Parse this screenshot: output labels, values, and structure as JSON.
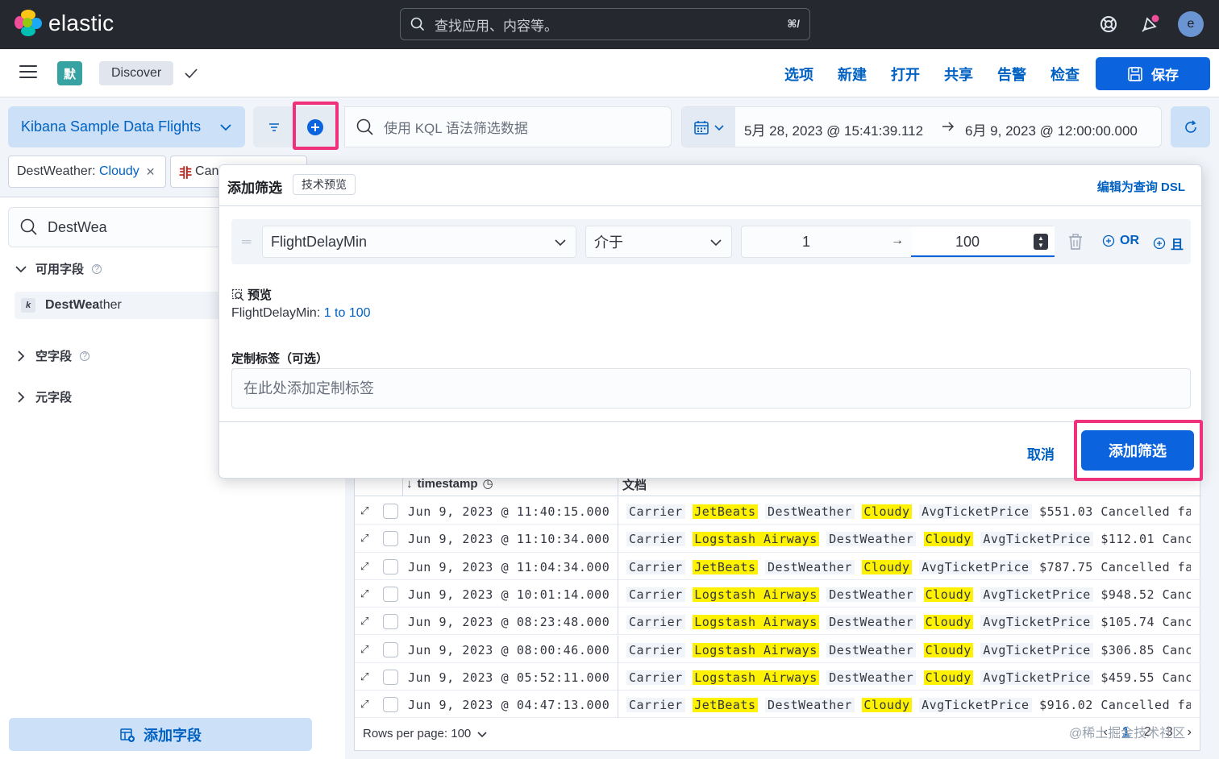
{
  "header": {
    "logo_text": "elastic",
    "search_placeholder": "查找应用、内容等。",
    "search_shortcut": "⌘/",
    "avatar_initial": "e"
  },
  "appbar": {
    "space_initial": "默",
    "breadcrumb": "Discover",
    "nav": [
      "选项",
      "新建",
      "打开",
      "共享",
      "告警",
      "检查"
    ],
    "save_label": "保存"
  },
  "querybar": {
    "data_view": "Kibana Sample Data Flights",
    "kql_placeholder": "使用 KQL 语法筛选数据",
    "date_start": "5月 28, 2023 @ 15:41:39.112",
    "date_end": "6月 9, 2023 @ 12:00:00.000"
  },
  "filters": [
    {
      "field": "DestWeather: ",
      "value": "Cloudy"
    },
    {
      "prefix": "非",
      "field": "Canc"
    }
  ],
  "sidebar": {
    "search_value": "DestWea",
    "available_label": "可用字段",
    "field_type": "k",
    "field_match": "DestWea",
    "field_rest": "ther",
    "empty_label": "空字段",
    "meta_label": "元字段",
    "add_field_label": "添加字段"
  },
  "popover": {
    "title": "添加筛选",
    "badge": "技术预览",
    "edit_dsl": "编辑为查询 DSL",
    "field": "FlightDelayMin",
    "operator": "介于",
    "from": "1",
    "to": "100",
    "or_label": "OR",
    "and_label": "且",
    "preview_title": "预览",
    "preview_field": "FlightDelayMin: ",
    "preview_value": "1 to 100",
    "label_title": "定制标签（可选）",
    "label_placeholder": "在此处添加定制标签",
    "cancel_label": "取消",
    "submit_label": "添加筛选"
  },
  "grid": {
    "col_timestamp": "timestamp",
    "col_document": "文档",
    "rows": [
      {
        "ts": "Jun 9, 2023 @ 11:40:15.000",
        "carrier": "JetBeats",
        "weather": "Cloudy",
        "price": "$551.03",
        "tail": "Cancelled false…"
      },
      {
        "ts": "Jun 9, 2023 @ 11:10:34.000",
        "carrier": "Logstash Airways",
        "weather": "Cloudy",
        "price": "$112.01",
        "tail": "Cancell…"
      },
      {
        "ts": "Jun 9, 2023 @ 11:04:34.000",
        "carrier": "JetBeats",
        "weather": "Cloudy",
        "price": "$787.75",
        "tail": "Cancelled false…"
      },
      {
        "ts": "Jun 9, 2023 @ 10:01:14.000",
        "carrier": "Logstash Airways",
        "weather": "Cloudy",
        "price": "$948.52",
        "tail": "Cancell…"
      },
      {
        "ts": "Jun 9, 2023 @ 08:23:48.000",
        "carrier": "Logstash Airways",
        "weather": "Cloudy",
        "price": "$105.74",
        "tail": "Cancell…"
      },
      {
        "ts": "Jun 9, 2023 @ 08:00:46.000",
        "carrier": "Logstash Airways",
        "weather": "Cloudy",
        "price": "$306.85",
        "tail": "Cancell…"
      },
      {
        "ts": "Jun 9, 2023 @ 05:52:11.000",
        "carrier": "Logstash Airways",
        "weather": "Cloudy",
        "price": "$459.55",
        "tail": "Cancell…"
      },
      {
        "ts": "Jun 9, 2023 @ 04:47:13.000",
        "carrier": "JetBeats",
        "weather": "Cloudy",
        "price": "$916.02",
        "tail": "Cancelled false…"
      }
    ],
    "doc_labels": {
      "carrier": "Carrier",
      "weather": "DestWeather",
      "price": "AvgTicketPrice"
    },
    "rows_per_page": "Rows per page: 100",
    "pages": [
      "1",
      "2",
      "3"
    ]
  },
  "watermark": "@稀土掘金技术社区",
  "colors": {
    "accent": "#0b64dd",
    "highlight": "#fff200",
    "callout": "#f0307a",
    "header_bg": "#25282f"
  }
}
